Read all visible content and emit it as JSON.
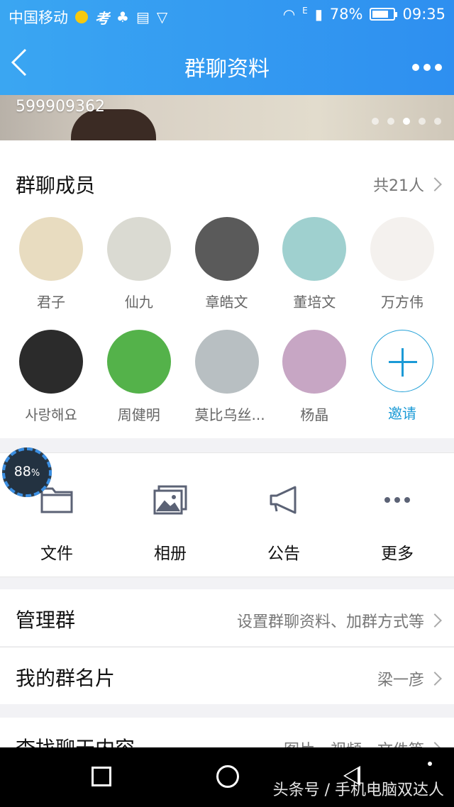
{
  "status_bar": {
    "carrier": "中国移动",
    "app_icon_text": "考",
    "network": "E",
    "battery": "78%",
    "battery_level": 0.78,
    "time": "09:35"
  },
  "header": {
    "title": "群聊资料",
    "back_icon": "chevron-left-icon",
    "more_icon": "more-horizontal-icon"
  },
  "banner": {
    "group_id": "599909362",
    "page_dots": 5,
    "active_dot": 3
  },
  "members": {
    "title": "群聊成员",
    "count_label": "共21人",
    "items": [
      {
        "name": "君子",
        "color": "#e8dcc0"
      },
      {
        "name": "仙九",
        "color": "#dadad2"
      },
      {
        "name": "章皓文",
        "color": "#5a5a5a"
      },
      {
        "name": "董培文",
        "color": "#9fd0cf"
      },
      {
        "name": "万方伟",
        "color": "#f4f1ee"
      },
      {
        "name": "사랑해요",
        "color": "#2b2b2b"
      },
      {
        "name": "周健明",
        "color": "#54b24a"
      },
      {
        "name": "莫比乌丝...",
        "color": "#b8bfc2"
      },
      {
        "name": "杨晶",
        "color": "#c7a6c4"
      }
    ],
    "invite_label": "邀请"
  },
  "quick_actions": [
    {
      "label": "文件",
      "icon": "folder-icon"
    },
    {
      "label": "相册",
      "icon": "photo-album-icon"
    },
    {
      "label": "公告",
      "icon": "megaphone-icon"
    },
    {
      "label": "更多",
      "icon": "more-dots-icon"
    }
  ],
  "overlay_badge": {
    "value": "88",
    "unit": "%"
  },
  "settings": {
    "manage": {
      "label": "管理群",
      "value": "设置群聊资料、加群方式等"
    },
    "card": {
      "label": "我的群名片",
      "value": "梁一彦"
    },
    "search": {
      "label": "查找聊天内容",
      "value": "图片、视频、文件等"
    }
  },
  "watermark": "头条号 / 手机电脑双达人"
}
